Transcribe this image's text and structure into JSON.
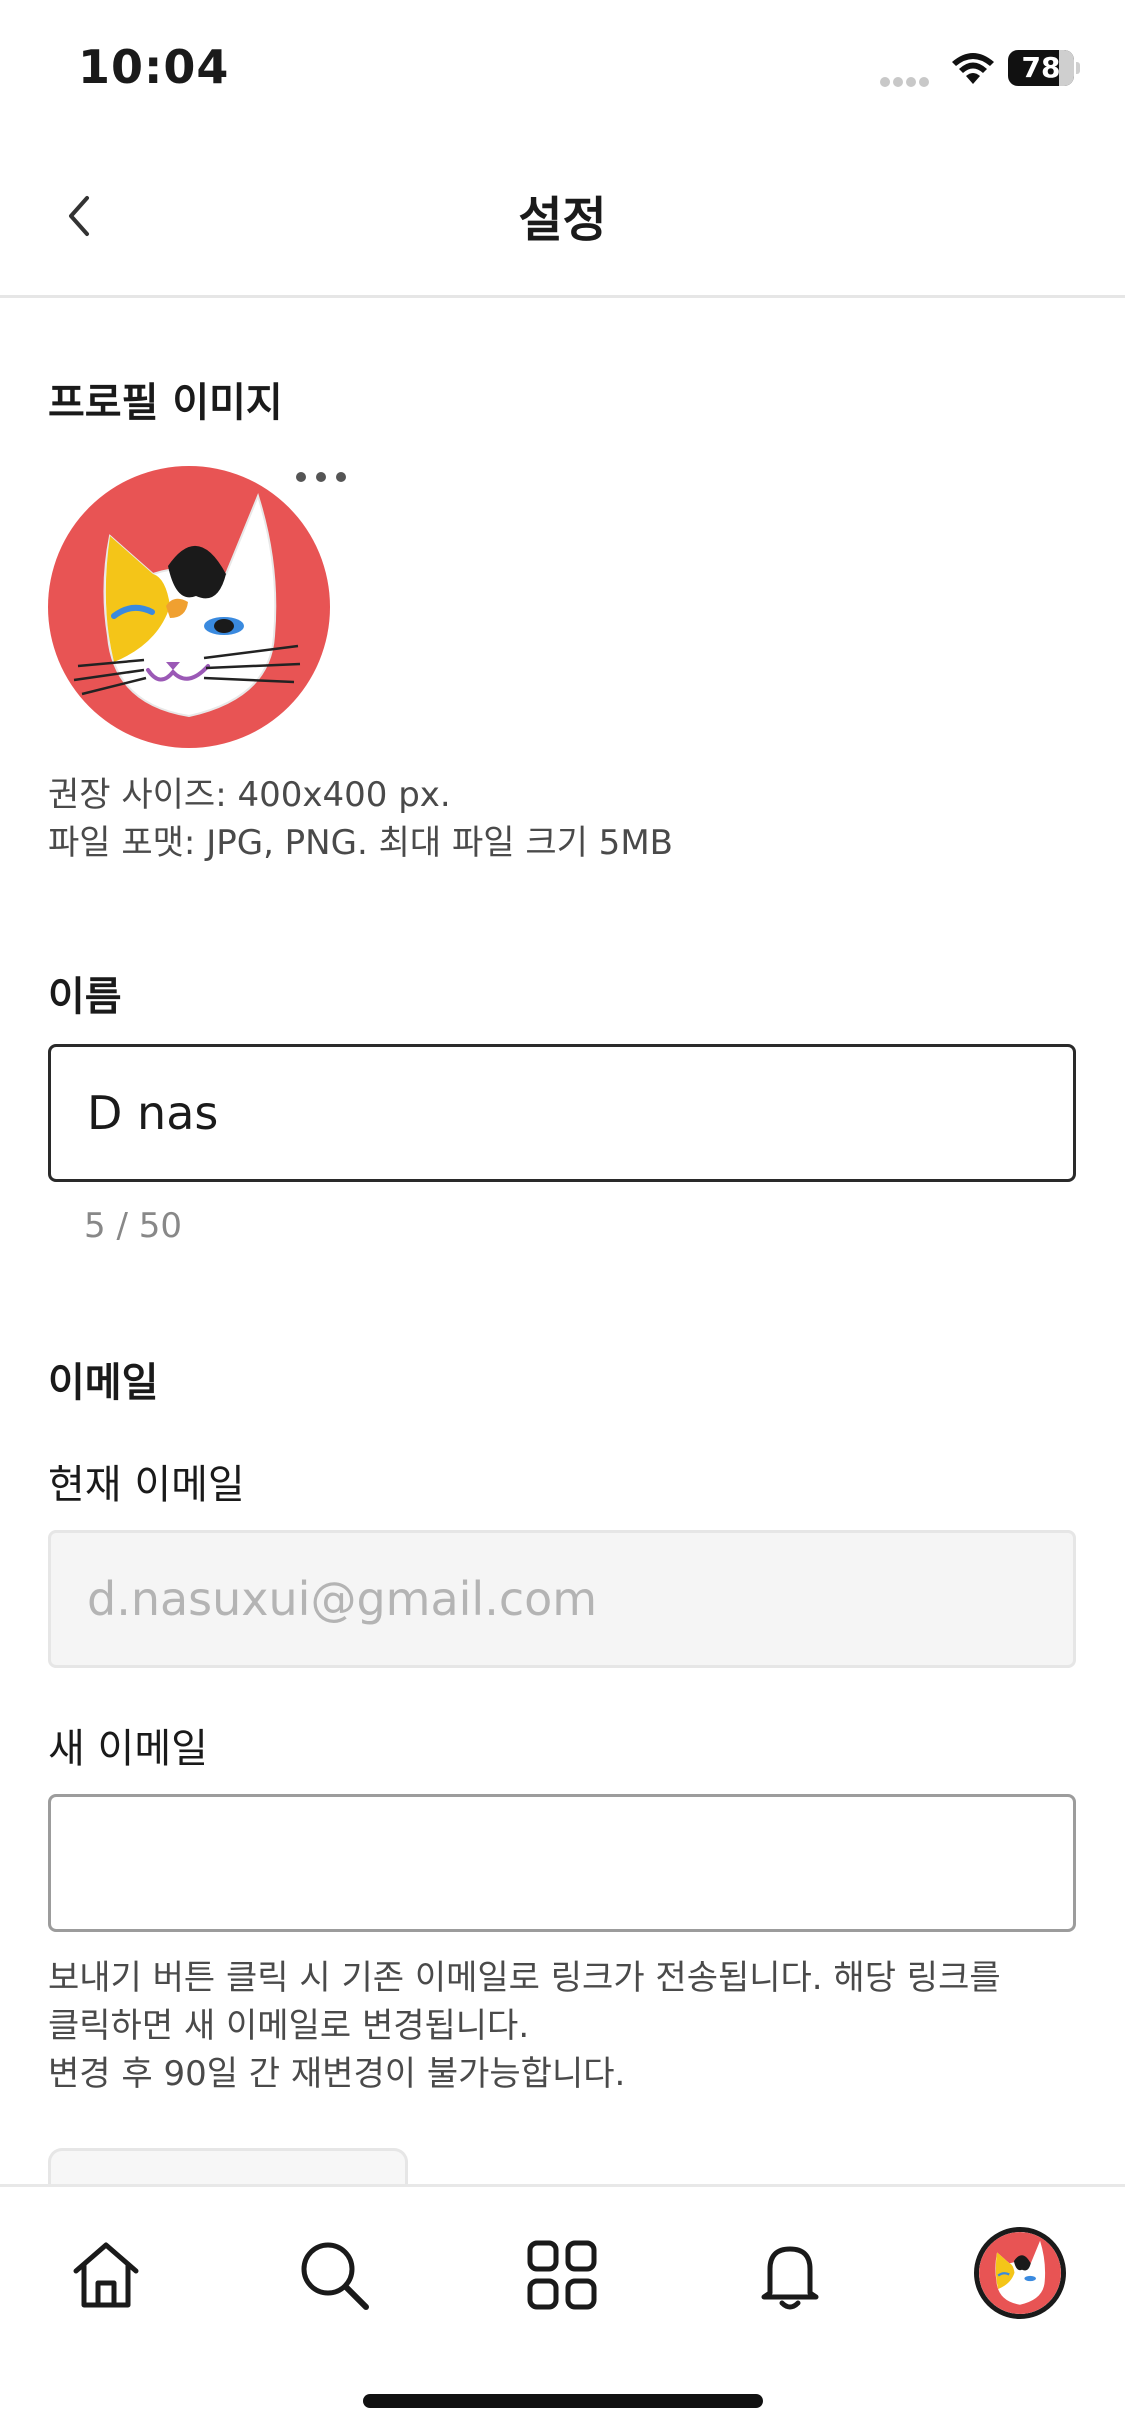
{
  "status_bar": {
    "time": "10:04",
    "battery": "78",
    "battery_level": 0.78
  },
  "header": {
    "title": "설정"
  },
  "profile_image": {
    "section_title": "프로필 이미지",
    "hint_line1": "권장 사이즈: 400x400 px.",
    "hint_line2": "파일 포맷: JPG, PNG. 최대 파일 크기 5MB"
  },
  "name": {
    "section_title": "이름",
    "value": "D nas",
    "char_count": "5 / 50"
  },
  "email": {
    "section_title": "이메일",
    "current_label": "현재 이메일",
    "current_value": "d.nasuxui@gmail.com",
    "new_label": "새 이메일",
    "new_value": "",
    "help_line1": "보내기 버튼 클릭 시 기존 이메일로 링크가 전송됩니다. 해당 링크를",
    "help_line2": "클릭하면 새 이메일로 변경됩니다.",
    "help_line3": "변경 후 90일 간 재변경이 불가능합니다."
  },
  "tab_bar": {
    "items": [
      {
        "icon": "home-icon"
      },
      {
        "icon": "search-icon"
      },
      {
        "icon": "grid-icon"
      },
      {
        "icon": "bell-icon"
      },
      {
        "icon": "profile-avatar"
      }
    ]
  },
  "colors": {
    "avatar_bg": "#e85454",
    "text_primary": "#1a1a1a",
    "text_muted": "#888888"
  }
}
